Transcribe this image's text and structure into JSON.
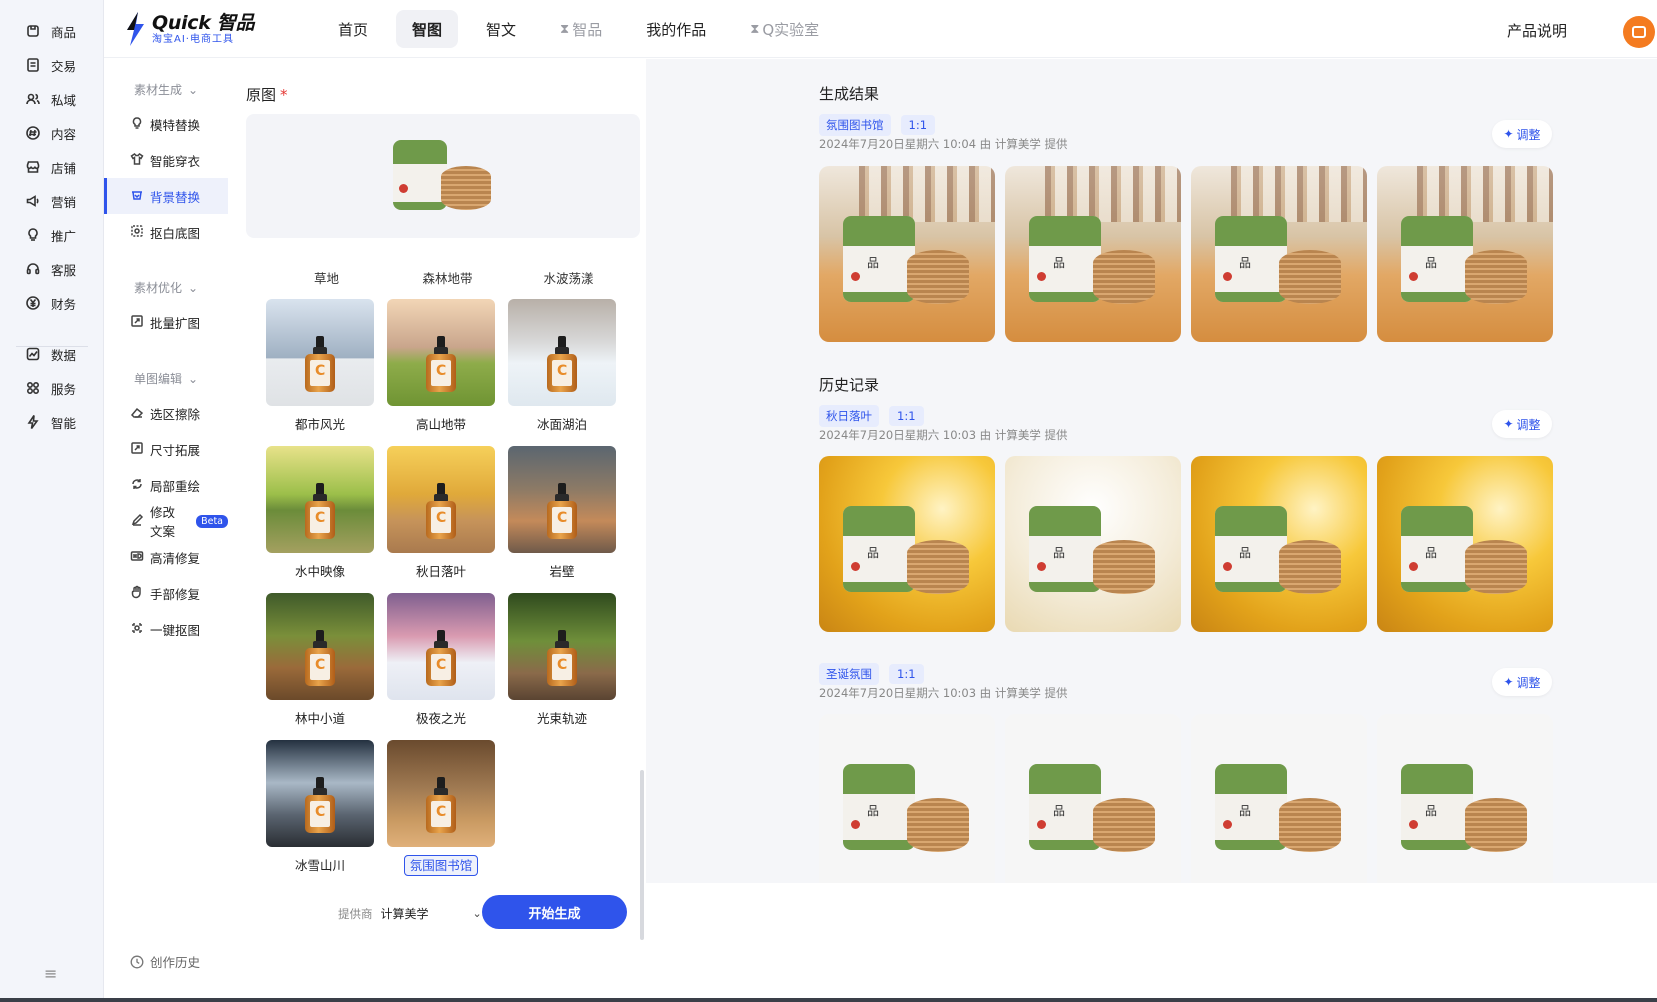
{
  "rail": {
    "items": [
      {
        "label": "商品",
        "icon": "product-icon"
      },
      {
        "label": "交易",
        "icon": "order-icon"
      },
      {
        "label": "私域",
        "icon": "users-icon"
      },
      {
        "label": "内容",
        "icon": "hash-icon"
      },
      {
        "label": "店铺",
        "icon": "store-icon"
      },
      {
        "label": "营销",
        "icon": "megaphone-icon"
      },
      {
        "label": "推广",
        "icon": "bulb-icon"
      },
      {
        "label": "客服",
        "icon": "headset-icon"
      },
      {
        "label": "财务",
        "icon": "yuan-icon"
      },
      {
        "label": "数据",
        "icon": "chart-icon"
      },
      {
        "label": "服务",
        "icon": "grid-icon"
      },
      {
        "label": "智能",
        "icon": "bolt-icon"
      }
    ],
    "menu_glyph": "≡"
  },
  "header": {
    "logo_title": "Quick 智品",
    "logo_sub": "淘宝AI·电商工具",
    "nav": [
      {
        "label": "首页",
        "active": false,
        "locked": false
      },
      {
        "label": "智图",
        "active": true,
        "locked": false
      },
      {
        "label": "智文",
        "active": false,
        "locked": false
      },
      {
        "label": "智品",
        "active": false,
        "locked": true
      },
      {
        "label": "我的作品",
        "active": false,
        "locked": false
      },
      {
        "label": "Q实验室",
        "active": false,
        "locked": true
      }
    ],
    "product_link": "产品说明",
    "accent": "#2f54eb",
    "avatar_color": "#f47b20"
  },
  "subside": {
    "groups": [
      {
        "title": "素材生成",
        "items": [
          {
            "label": "模特替换",
            "icon": "model-icon"
          },
          {
            "label": "智能穿衣",
            "icon": "shirt-icon"
          },
          {
            "label": "背景替换",
            "icon": "background-icon",
            "active": true
          },
          {
            "label": "抠白底图",
            "icon": "cutout-icon"
          }
        ]
      },
      {
        "title": "素材优化",
        "items": [
          {
            "label": "批量扩图",
            "icon": "expand-icon"
          }
        ]
      },
      {
        "title": "单图编辑",
        "items": [
          {
            "label": "选区擦除",
            "icon": "eraser-icon"
          },
          {
            "label": "尺寸拓展",
            "icon": "resize-icon"
          },
          {
            "label": "局部重绘",
            "icon": "repaint-icon"
          },
          {
            "label": "修改文案",
            "icon": "pen-icon",
            "badge": "Beta"
          },
          {
            "label": "高清修复",
            "icon": "hd-icon"
          },
          {
            "label": "手部修复",
            "icon": "hand-icon"
          },
          {
            "label": "一键抠图",
            "icon": "crop-icon"
          }
        ]
      }
    ],
    "history": "创作历史"
  },
  "config": {
    "section_label": "原图",
    "required_mark": "*",
    "top_row_labels": [
      "草地",
      "森林地带",
      "水波荡漾"
    ],
    "scenes": [
      {
        "label": "都市风光",
        "style": "t-city"
      },
      {
        "label": "高山地带",
        "style": "t-mountain"
      },
      {
        "label": "冰面湖泊",
        "style": "t-ice"
      },
      {
        "label": "水中映像",
        "style": "t-water"
      },
      {
        "label": "秋日落叶",
        "style": "t-autumn"
      },
      {
        "label": "岩壁",
        "style": "t-rock"
      },
      {
        "label": "林中小道",
        "style": "t-forest"
      },
      {
        "label": "极夜之光",
        "style": "t-polar"
      },
      {
        "label": "光束轨迹",
        "style": "t-ray"
      },
      {
        "label": "冰雪山川",
        "style": "t-snow"
      },
      {
        "label": "氛围图书馆",
        "style": "t-library",
        "selected": true
      }
    ],
    "provider_label": "提供商",
    "provider_value": "计算美学",
    "generate_button": "开始生成"
  },
  "results": {
    "current_title": "生成结果",
    "history_title": "历史记录",
    "adjust_label": "调整",
    "groups": [
      {
        "tag": "氛围图书馆",
        "ratio": "1:1",
        "meta": "2024年7月20日星期六 10:04 由 计算美学 提供",
        "bg": "bg-library"
      },
      {
        "tag": "秋日落叶",
        "ratio": "1:1",
        "meta": "2024年7月20日星期六 10:03 由 计算美学 提供",
        "bg": "bg-autumn"
      },
      {
        "tag": "圣诞氛围",
        "ratio": "1:1",
        "meta": "2024年7月20日星期六 10:03 由 计算美学 提供",
        "bg": "bg-plain"
      }
    ]
  }
}
